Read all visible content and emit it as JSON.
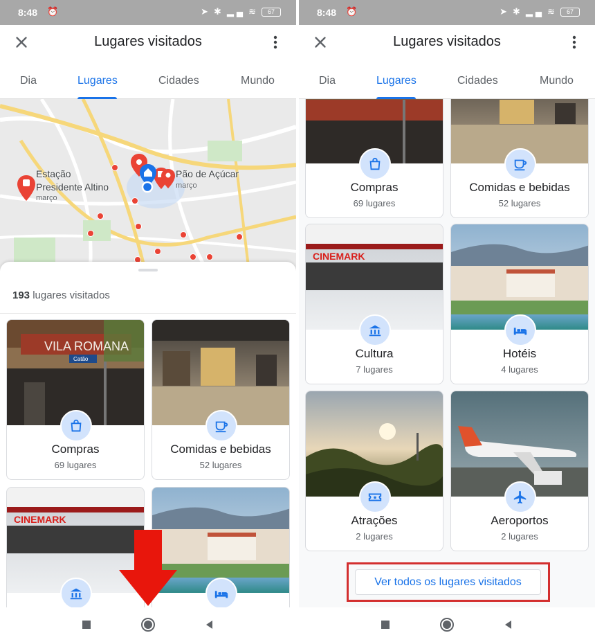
{
  "status": {
    "time": "8:48",
    "battery": "67"
  },
  "header": {
    "title": "Lugares visitados"
  },
  "tabs": [
    {
      "label": "Dia"
    },
    {
      "label": "Lugares"
    },
    {
      "label": "Cidades"
    },
    {
      "label": "Mundo"
    }
  ],
  "active_tab": "Lugares",
  "map": {
    "labels": [
      {
        "name": "Estação",
        "name2": "Presidente Altino",
        "sub": "março"
      },
      {
        "name": "Pão de Açúcar",
        "sub": "março"
      }
    ]
  },
  "summary": {
    "count": "193",
    "suffix": " lugares visitados"
  },
  "categories": [
    {
      "name": "Compras",
      "count": "69 lugares",
      "icon": "shopping-bag-icon"
    },
    {
      "name": "Comidas e bebidas",
      "count": "52 lugares",
      "icon": "coffee-cup-icon"
    },
    {
      "name": "Cultura",
      "count": "7 lugares",
      "icon": "museum-icon"
    },
    {
      "name": "Hotéis",
      "count": "4 lugares",
      "icon": "bed-icon"
    },
    {
      "name": "Atrações",
      "count": "2 lugares",
      "icon": "ticket-icon"
    },
    {
      "name": "Aeroportos",
      "count": "2 lugares",
      "icon": "airplane-icon"
    }
  ],
  "photo_text": {
    "vila": "VILA ROMANA",
    "cinemark": "CINEMARK",
    "catao": "Catão"
  },
  "view_all": {
    "label": "Ver todos os lugares visitados"
  },
  "colors": {
    "accent": "#1a73e8",
    "icon_bg": "#d2e3fc",
    "highlight": "#d32f2f",
    "arrow": "#e8160c",
    "pin": "#ea4335"
  }
}
